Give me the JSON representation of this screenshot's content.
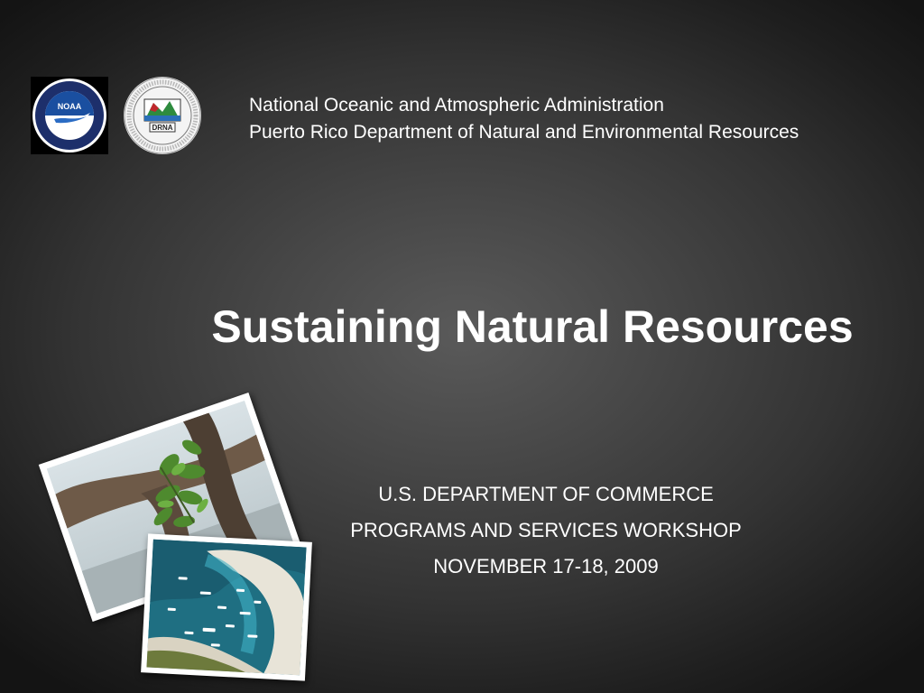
{
  "header": {
    "agency_line_1": "National Oceanic and Atmospheric Administration",
    "agency_line_2": "Puerto Rico Department of Natural and Environmental Resources"
  },
  "logos": {
    "noaa": {
      "icon": "noaa-logo-icon",
      "text": "NOAA"
    },
    "drna": {
      "icon": "drna-logo-icon",
      "text": "DRNA"
    }
  },
  "title": "Sustaining Natural Resources",
  "subtitle": {
    "line_1": "U.S. DEPARTMENT OF COMMERCE",
    "line_2": "PROGRAMS AND SERVICES WORKSHOP",
    "line_3": "NOVEMBER 17-18, 2009"
  },
  "photos": [
    {
      "icon": "mangrove-plant-photo"
    },
    {
      "icon": "bay-boats-aerial-photo"
    }
  ],
  "colors": {
    "text": "#ffffff",
    "background_center": "#5a5a5a",
    "background_edge": "#141414",
    "noaa_blue": "#1a4fa0"
  }
}
